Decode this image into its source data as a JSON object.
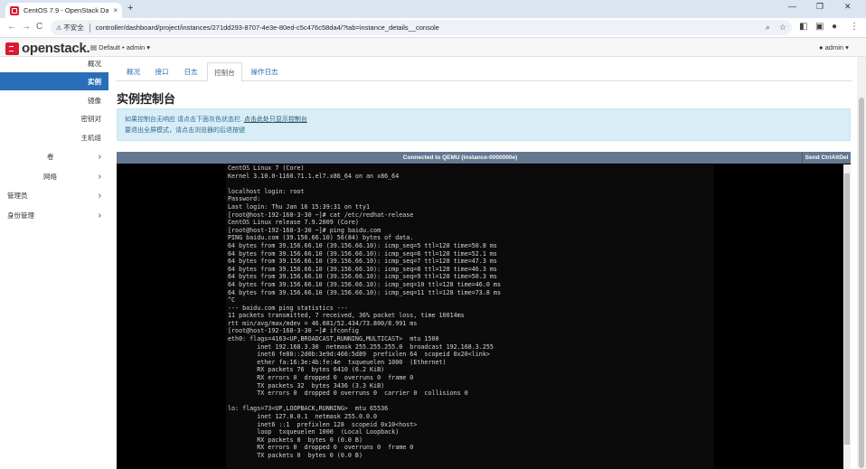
{
  "browser": {
    "tab_title": "CentOS 7.9 - OpenStack Das",
    "tab_close": "×",
    "new_tab": "+",
    "back": "←",
    "forward": "→",
    "reload": "C",
    "insecure_label": "不安全",
    "url": "controller/dashboard/project/instances/271dd293-8707-4e3e-80ed-c5c476c58da4/?tab=instance_details__console",
    "window_controls": {
      "minimize": "—",
      "restore": "❐",
      "close": "✕"
    }
  },
  "header": {
    "logo_text": "openstack.",
    "project_switcher": "Default • admin ▾",
    "user_menu": "admin ▾"
  },
  "sidebar": {
    "items": [
      {
        "label": "概况"
      },
      {
        "label": "实例"
      },
      {
        "label": "镜像"
      },
      {
        "label": "密钥对"
      },
      {
        "label": "主机组"
      },
      {
        "label": "卷"
      },
      {
        "label": "网络"
      },
      {
        "label": "管理员"
      },
      {
        "label": "身份管理"
      }
    ],
    "caret": "›"
  },
  "tabs": [
    {
      "label": "概况"
    },
    {
      "label": "接口"
    },
    {
      "label": "日志"
    },
    {
      "label": "控制台"
    },
    {
      "label": "操作日志"
    }
  ],
  "page_title": "实例控制台",
  "info": {
    "line1_prefix": "如果控制台无响应 请点击下面灰色状态栏.",
    "line1_link": "点击此处只显示控制台",
    "line2": "要退出全屏模式，请点击浏览器的后退按键"
  },
  "console": {
    "status": "Connected to QEMU (instance-0000000e)",
    "send_cad": "Send CtrlAltDel",
    "lines": [
      "CentOS Linux 7 (Core)",
      "Kernel 3.10.0-1160.71.1.el7.x86_64 on an x86_64",
      "",
      "localhost login: root",
      "Password:",
      "Last login: Thu Jan 16 15:39:31 on tty1",
      "[root@host-192-168-3-30 ~]# cat /etc/redhat-release",
      "CentOS Linux release 7.9.2009 (Core)",
      "[root@host-192-168-3-30 ~]# ping baidu.com",
      "PING baidu.com (39.156.66.10) 56(84) bytes of data.",
      "64 bytes from 39.156.66.10 (39.156.66.10): icmp_seq=5 ttl=128 time=50.8 ms",
      "64 bytes from 39.156.66.10 (39.156.66.10): icmp_seq=6 ttl=128 time=52.1 ms",
      "64 bytes from 39.156.66.10 (39.156.66.10): icmp_seq=7 ttl=128 time=47.3 ms",
      "64 bytes from 39.156.66.10 (39.156.66.10): icmp_seq=8 ttl=128 time=46.3 ms",
      "64 bytes from 39.156.66.10 (39.156.66.10): icmp_seq=9 ttl=128 time=50.3 ms",
      "64 bytes from 39.156.66.10 (39.156.66.10): icmp_seq=10 ttl=128 time=46.0 ms",
      "64 bytes from 39.156.66.10 (39.156.66.10): icmp_seq=11 ttl=128 time=73.8 ms",
      "^C",
      "--- baidu.com ping statistics ---",
      "11 packets transmitted, 7 received, 36% packet loss, time 10014ms",
      "rtt min/avg/max/mdev = 46.081/52.434/73.800/8.991 ms",
      "[root@host-192-168-3-30 ~]# ifconfig",
      "eth0: flags=4163<UP,BROADCAST,RUNNING,MULTICAST>  mtu 1500",
      "        inet 192.168.3.30  netmask 255.255.255.0  broadcast 192.168.3.255",
      "        inet6 fe80::2d0b:3e9d:466:5d89  prefixlen 64  scopeid 0x20<link>",
      "        ether fa:16:3e:4b:fe:4e  txqueuelen 1000  (Ethernet)",
      "        RX packets 76  bytes 6410 (6.2 KiB)",
      "        RX errors 0  dropped 0  overruns 0  frame 0",
      "        TX packets 32  bytes 3436 (3.3 KiB)",
      "        TX errors 0  dropped 0 overruns 0  carrier 0  collisions 0",
      "",
      "lo: flags=73<UP,LOOPBACK,RUNNING>  mtu 65536",
      "        inet 127.0.0.1  netmask 255.0.0.0",
      "        inet6 ::1  prefixlen 128  scopeid 0x10<host>",
      "        loop  txqueuelen 1000  (Local Loopback)",
      "        RX packets 0  bytes 0 (0.0 B)",
      "        RX errors 0  dropped 0  overruns 0  frame 0",
      "        TX packets 0  bytes 0 (0.0 B)"
    ]
  },
  "colors": {
    "accent": "#2a6eb8",
    "brand_red": "#da1a32",
    "info_bg": "#d9edf7",
    "console_bar": "#647891"
  }
}
